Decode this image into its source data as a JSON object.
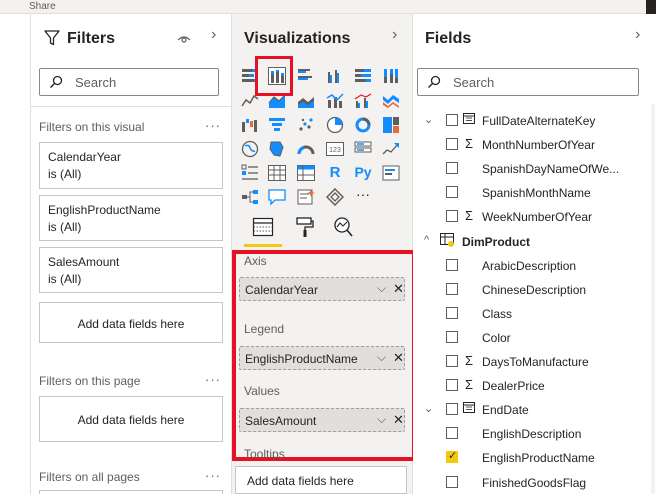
{
  "top": {
    "share_label": "Share"
  },
  "filters": {
    "title": "Filters",
    "search_placeholder": "Search",
    "on_visual_label": "Filters on this visual",
    "on_page_label": "Filters on this page",
    "all_pages_label": "Filters on all pages",
    "more": "···",
    "cards": [
      {
        "name": "CalendarYear",
        "value": "is (All)"
      },
      {
        "name": "EnglishProductName",
        "value": "is (All)"
      },
      {
        "name": "SalesAmount",
        "value": "is (All)"
      }
    ],
    "add_fields": "Add data fields here"
  },
  "visualizations": {
    "title": "Visualizations",
    "more_visuals": "···",
    "wells": {
      "axis": {
        "label": "Axis",
        "field": "CalendarYear"
      },
      "legend": {
        "label": "Legend",
        "field": "EnglishProductName"
      },
      "values": {
        "label": "Values",
        "field": "SalesAmount"
      },
      "tooltips": {
        "label": "Tooltips",
        "add": "Add data fields here"
      }
    },
    "selected_visual": "stacked-column-chart",
    "highlight_color": "#e81123",
    "accent_color": "#f2c811"
  },
  "fields": {
    "title": "Fields",
    "search_placeholder": "Search",
    "rows": [
      {
        "caret": "⌄",
        "icon": "calendar",
        "name": "FullDateAlternateKey",
        "checked": false
      },
      {
        "caret": "",
        "icon": "sigma",
        "name": "MonthNumberOfYear",
        "checked": false
      },
      {
        "caret": "",
        "icon": "",
        "name": "SpanishDayNameOfWe...",
        "checked": false
      },
      {
        "caret": "",
        "icon": "",
        "name": "SpanishMonthName",
        "checked": false
      },
      {
        "caret": "",
        "icon": "sigma",
        "name": "WeekNumberOfYear",
        "checked": false
      },
      {
        "caret": "^",
        "icon": "table",
        "name": "DimProduct",
        "checked": true,
        "table": true
      },
      {
        "caret": "",
        "icon": "",
        "name": "ArabicDescription",
        "checked": false
      },
      {
        "caret": "",
        "icon": "",
        "name": "ChineseDescription",
        "checked": false
      },
      {
        "caret": "",
        "icon": "",
        "name": "Class",
        "checked": false
      },
      {
        "caret": "",
        "icon": "",
        "name": "Color",
        "checked": false
      },
      {
        "caret": "",
        "icon": "sigma",
        "name": "DaysToManufacture",
        "checked": false
      },
      {
        "caret": "",
        "icon": "sigma",
        "name": "DealerPrice",
        "checked": false
      },
      {
        "caret": "⌄",
        "icon": "calendar",
        "name": "EndDate",
        "checked": false
      },
      {
        "caret": "",
        "icon": "",
        "name": "EnglishDescription",
        "checked": false
      },
      {
        "caret": "",
        "icon": "",
        "name": "EnglishProductName",
        "checked": true
      },
      {
        "caret": "",
        "icon": "",
        "name": "FinishedGoodsFlag",
        "checked": false
      }
    ]
  }
}
